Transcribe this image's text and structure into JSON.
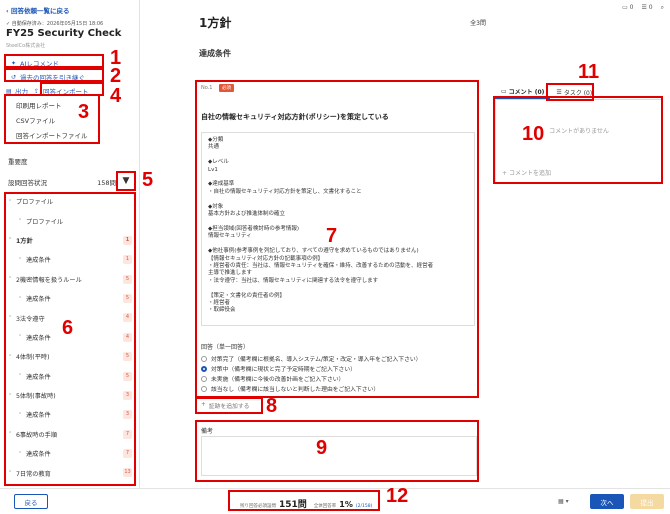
{
  "sidebar": {
    "back_link": "回答依頼一覧に戻る",
    "deadline": "自動保存済み：2026年05月15日 18:06",
    "check_title": "FY25 Security Check",
    "org": "SteelCo株式会社",
    "ai_recommend": "AIレコメンド",
    "copy_past": "過去の回答を引き継ぐ",
    "export": "出力",
    "import": "回答インポート",
    "dropdown": [
      "印刷用レポート",
      "CSVファイル",
      "回答インポートファイル"
    ],
    "importance": "重要度",
    "status_label": "設問回答状況",
    "status_count": "158問",
    "tree": [
      {
        "label": "プロファイル",
        "level": 0,
        "badge": ""
      },
      {
        "label": "プロファイル",
        "level": 1,
        "badge": ""
      },
      {
        "label": "1方針",
        "level": 0,
        "badge": "1",
        "active": true
      },
      {
        "label": "達成条件",
        "level": 1,
        "badge": "1"
      },
      {
        "label": "2機密情報を扱うルール",
        "level": 0,
        "badge": "5"
      },
      {
        "label": "達成条件",
        "level": 1,
        "badge": "5"
      },
      {
        "label": "3法令遵守",
        "level": 0,
        "badge": "4"
      },
      {
        "label": "達成条件",
        "level": 1,
        "badge": "4"
      },
      {
        "label": "4体制(平時)",
        "level": 0,
        "badge": "5"
      },
      {
        "label": "達成条件",
        "level": 1,
        "badge": "5"
      },
      {
        "label": "5体制(事故時)",
        "level": 0,
        "badge": "3"
      },
      {
        "label": "達成条件",
        "level": 1,
        "badge": "3"
      },
      {
        "label": "6事故時の手順",
        "level": 0,
        "badge": "7"
      },
      {
        "label": "達成条件",
        "level": 1,
        "badge": "7"
      },
      {
        "label": "7日常の教育",
        "level": 0,
        "badge": "13"
      }
    ]
  },
  "main": {
    "title": "1方針",
    "count": "全3問",
    "section": "達成条件",
    "qno": "No.1",
    "required": "必須",
    "question": "自社の情報セキュリティ対応方針(ポリシー)を策定している",
    "detail": "◆分類\n共通\n\n◆レベル\nLv1\n\n◆達成基準\n・自社の情報セキュリティ対応方針を策定し、文書化すること\n\n◆対象\n基本方針および推進体制の確立\n\n◆担当領域(回答者検討時の参考情報)\n情報セキュリティ\n\n◆他社事例(参考事例を列記しており、すべての遵守を求めているものではありません)\n【情報セキュリティ対応方針の記載事項の例】\n・経営者の責任：当社は、情報セキュリティを確保・維持、改善するための活動を、経営者\n主導で推進します\n・法令遵守：当社は、情報セキュリティに関連する法令を遵守します\n\n【策定・文書化の責任者の例】\n・経営者\n・取締役会",
    "answer_label": "回答（単一回答）",
    "options": [
      "対策完了（備考欄に根拠名、導入システム/策定・改定・導入年をご記入下さい）",
      "対策中（備考欄に現状と完了予定時期をご記入下さい）",
      "未実施（備考欄に今後の改善計画をご記入下さい）",
      "該当なし（備考欄に該当しないと判断した理由をご記入下さい）"
    ],
    "selected_option": 1,
    "add_evidence": "証跡を追加する",
    "memo_label": "備考"
  },
  "right": {
    "top_comment_count": "0",
    "top_task_count": "0",
    "tab_comment": "コメント (0)",
    "tab_task": "タスク (0)",
    "no_comment": "コメントがありません",
    "add_comment": "コメントを追加"
  },
  "bottom": {
    "back": "戻る",
    "remaining_label": "残り回答必須設問",
    "remaining_value": "151問",
    "rate_label": "全体回答率",
    "rate_value": "1%",
    "rate_frac": "(2/158)",
    "next": "次へ",
    "submit": "提出"
  },
  "callouts": [
    "1",
    "2",
    "3",
    "4",
    "5",
    "6",
    "7",
    "8",
    "9",
    "10",
    "11",
    "12"
  ],
  "colors": {
    "accent": "#1a56b8",
    "annotation": "#e00000",
    "badge_bg": "#fde5e0",
    "badge_fg": "#e0573a",
    "submit_disabled": "#f4d9a0"
  }
}
